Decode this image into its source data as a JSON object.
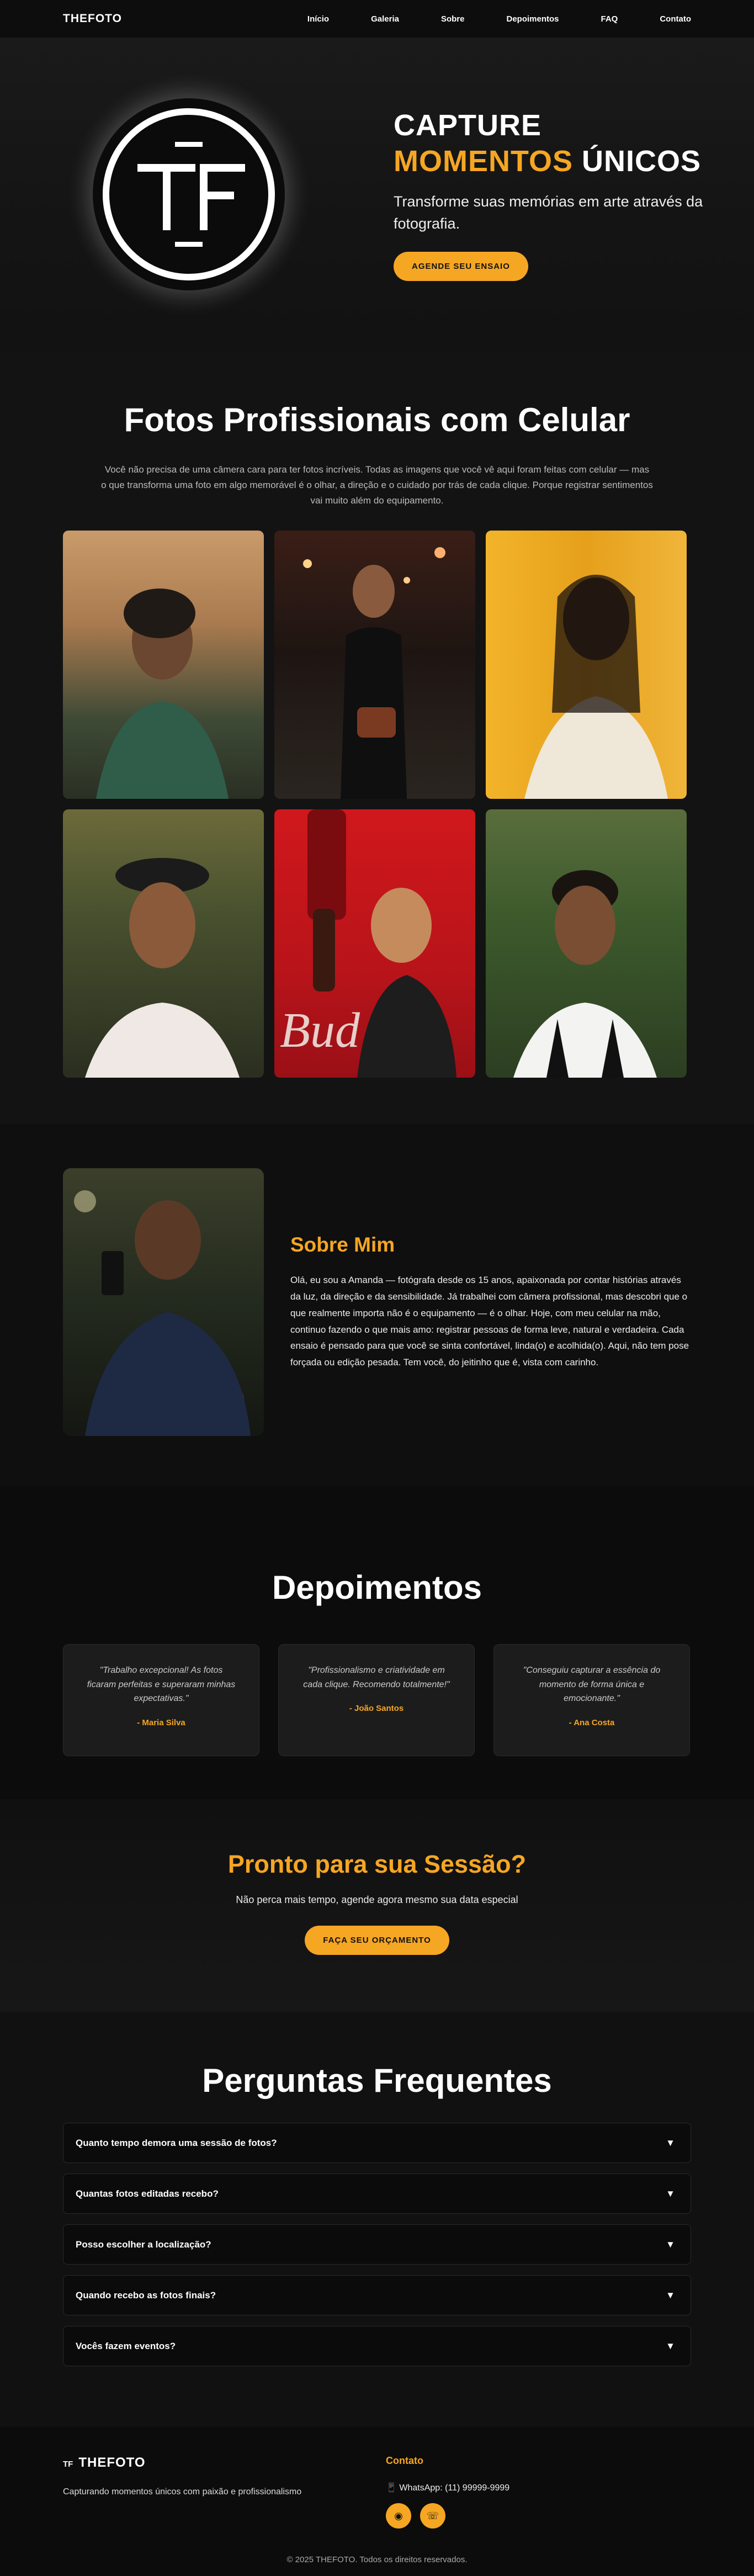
{
  "nav": {
    "brand": "THEFOTO",
    "links": [
      "Início",
      "Galeria",
      "Sobre",
      "Depoimentos",
      "FAQ",
      "Contato"
    ]
  },
  "hero": {
    "title_line1": "CAPTURE",
    "title_gold": "MOMENTOS",
    "title_rest": " ÚNICOS",
    "subtitle": "Transforme suas memórias em arte através da fotografia.",
    "button": "AGENDE SEU ENSAIO",
    "logo_letters": "TF"
  },
  "phones": {
    "title": "Fotos Profissionais com Celular",
    "description": "Você não precisa de uma câmera cara para ter fotos incríveis. Todas as imagens que você vê aqui foram feitas com celular — mas o que transforma uma foto em algo memorável é o olhar, a direção e o cuidado por trás de cada clique. Porque registrar sentimentos vai muito além do equipamento."
  },
  "about": {
    "title": "Sobre Mim",
    "text": "Olá, eu sou a Amanda — fotógrafa desde os 15 anos, apaixonada por contar histórias através da luz, da direção e da sensibilidade. Já trabalhei com câmera profissional, mas descobri que o que realmente importa não é o equipamento — é o olhar. Hoje, com meu celular na mão, continuo fazendo o que mais amo: registrar pessoas de forma leve, natural e verdadeira. Cada ensaio é pensado para que você se sinta confortável, linda(o) e acolhida(o). Aqui, não tem pose forçada ou edição pesada. Tem você, do jeitinho que é, vista com carinho."
  },
  "testimonials": {
    "title": "Depoimentos",
    "items": [
      {
        "quote": "\"Trabalho excepcional! As fotos ficaram perfeitas e superaram minhas expectativas.\"",
        "author": "- Maria Silva"
      },
      {
        "quote": "\"Profissionalismo e criatividade em cada clique. Recomendo totalmente!\"",
        "author": "- João Santos"
      },
      {
        "quote": "\"Conseguiu capturar a essência do momento de forma única e emocionante.\"",
        "author": "- Ana Costa"
      }
    ]
  },
  "cta": {
    "title": "Pronto para sua Sessão?",
    "subtitle": "Não perca mais tempo, agende agora mesmo sua data especial",
    "button": "FAÇA SEU ORÇAMENTO"
  },
  "faq": {
    "title": "Perguntas Frequentes",
    "items": [
      "Quanto tempo demora uma sessão de fotos?",
      "Quantas fotos editadas recebo?",
      "Posso escolher a localização?",
      "Quando recebo as fotos finais?",
      "Vocês fazem eventos?"
    ],
    "arrow": "▼"
  },
  "footer": {
    "logo_small": "TF",
    "brand": "THEFOTO",
    "tagline": "Capturando momentos únicos com paixão e profissionalismo",
    "contact_title": "Contato",
    "phone": "WhatsApp: (11) 99999-9999",
    "copyright": "© 2025 THEFOTO. Todos os direitos reservados."
  },
  "colors": {
    "accent": "#f5a623",
    "background": "#121212"
  }
}
